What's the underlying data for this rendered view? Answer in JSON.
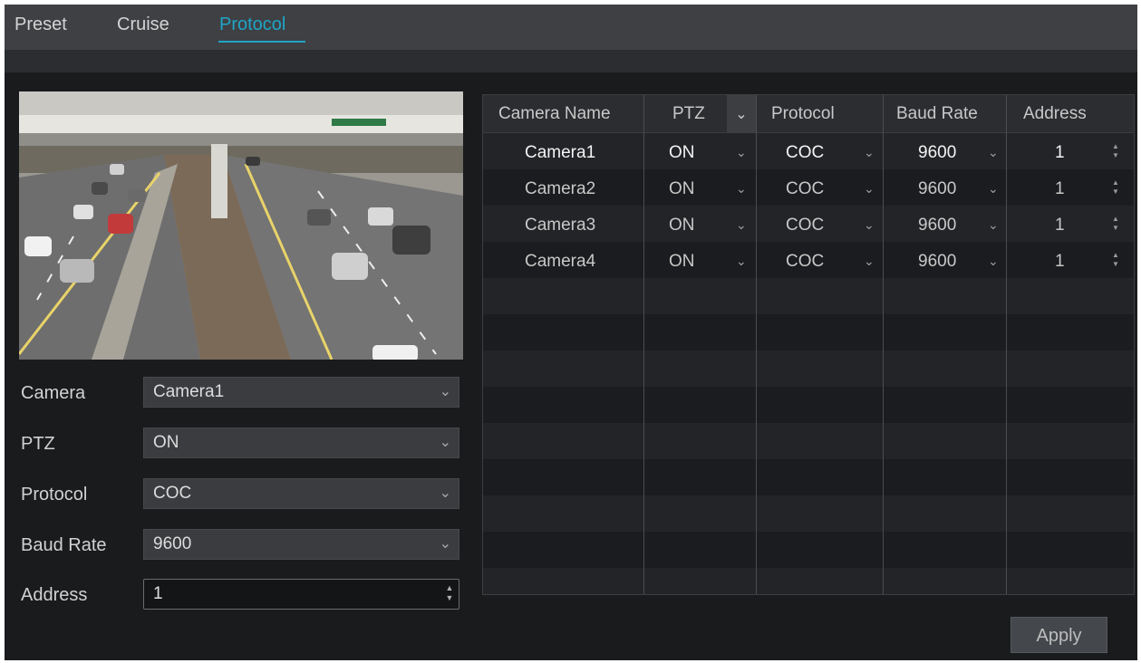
{
  "tabs": [
    {
      "label": "Preset"
    },
    {
      "label": "Cruise"
    },
    {
      "label": "Protocol",
      "active": true
    }
  ],
  "form": {
    "camera": {
      "label": "Camera",
      "value": "Camera1"
    },
    "ptz": {
      "label": "PTZ",
      "value": "ON"
    },
    "protocol": {
      "label": "Protocol",
      "value": "COC"
    },
    "baud_rate": {
      "label": "Baud Rate",
      "value": "9600"
    },
    "address": {
      "label": "Address",
      "value": "1"
    }
  },
  "table": {
    "columns": [
      "Camera Name",
      "PTZ",
      "Protocol",
      "Baud Rate",
      "Address"
    ],
    "rows": [
      {
        "name": "Camera1",
        "ptz": "ON",
        "protocol": "COC",
        "baud": "9600",
        "address": "1",
        "selected": true
      },
      {
        "name": "Camera2",
        "ptz": "ON",
        "protocol": "COC",
        "baud": "9600",
        "address": "1"
      },
      {
        "name": "Camera3",
        "ptz": "ON",
        "protocol": "COC",
        "baud": "9600",
        "address": "1"
      },
      {
        "name": "Camera4",
        "ptz": "ON",
        "protocol": "COC",
        "baud": "9600",
        "address": "1"
      }
    ]
  },
  "buttons": {
    "apply": "Apply"
  },
  "icons": {
    "dropdown": "chevron-down-icon",
    "stepper": "spinner-arrows-icon"
  },
  "colors": {
    "accent": "#1fa5c8",
    "background": "#1a1b1d",
    "tabbar": "#3e4043"
  }
}
